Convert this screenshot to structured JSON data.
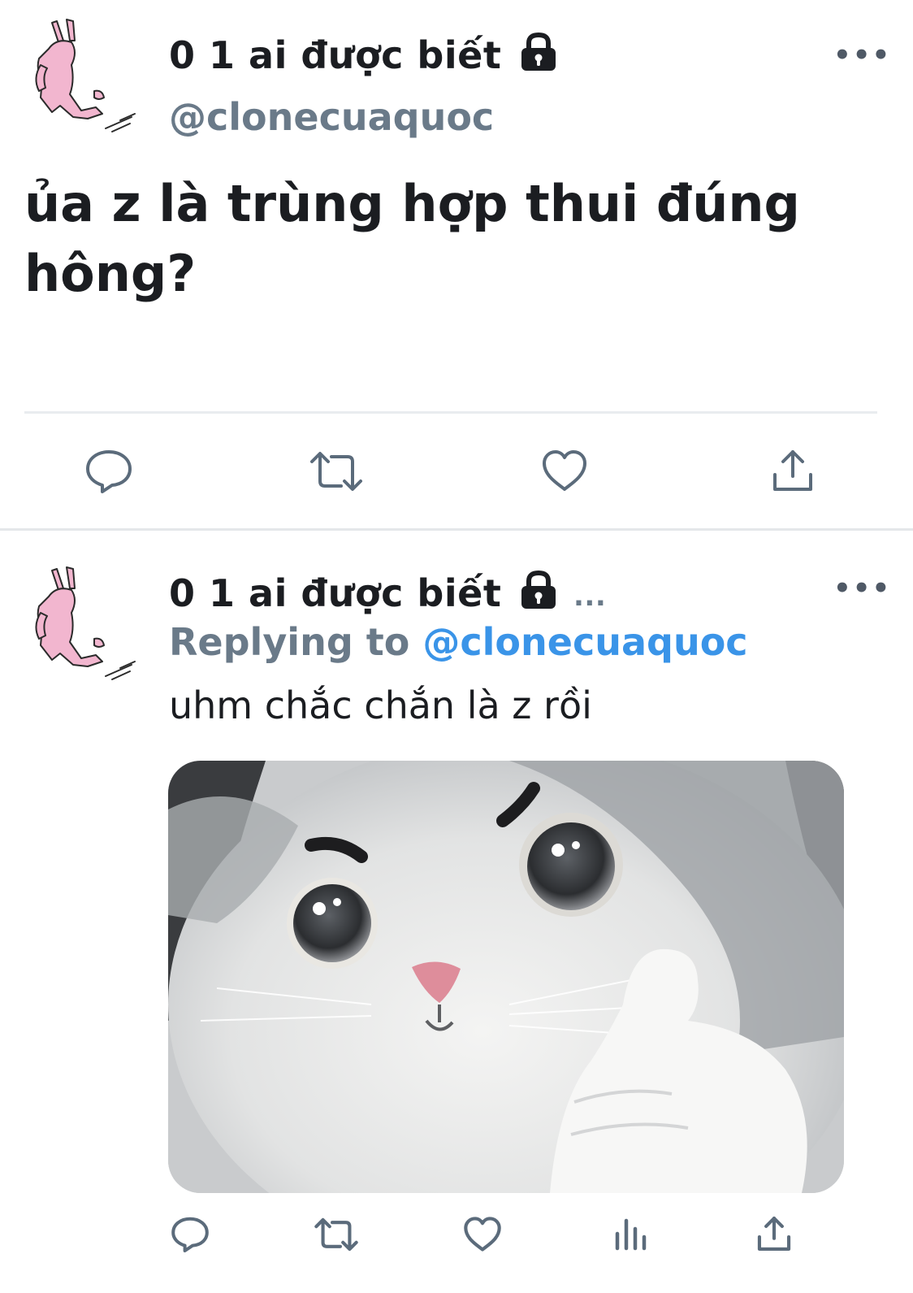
{
  "tweet": {
    "display_name": "0 1 ai được biết",
    "handle": "@clonecuaquoc",
    "text": "ủa z là trùng hợp thui đúng hông?",
    "actions": [
      "reply-icon",
      "retweet-icon",
      "like-icon",
      "share-icon"
    ]
  },
  "reply": {
    "display_name": "0 1 ai được biết",
    "name_overflow": "...",
    "replying_to_prefix": "Replying to",
    "replying_to_handle": "@clonecuaquoc",
    "text": "uhm chắc chắn là z rồi",
    "actions": [
      "reply-icon",
      "retweet-icon",
      "like-icon",
      "analytics-icon",
      "share-icon"
    ]
  },
  "colors": {
    "text": "#1b1d21",
    "muted": "#6a7a89",
    "link": "#3a94e8",
    "icon": "#5b6b7b",
    "avatar_pink": "#f2b6cf"
  }
}
